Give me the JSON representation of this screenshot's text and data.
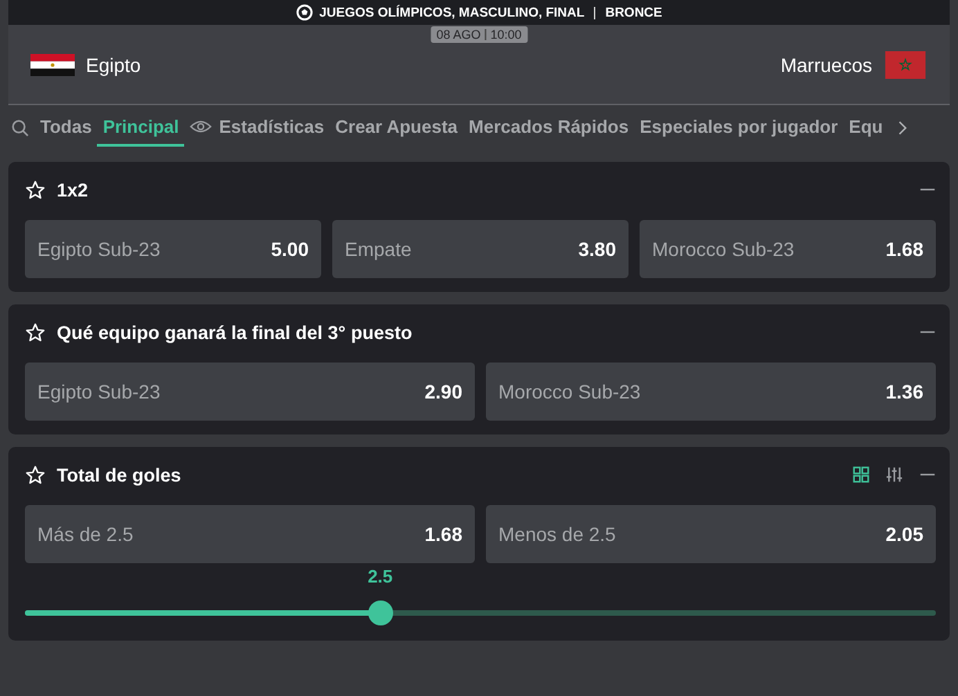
{
  "event": {
    "competition": "JUEGOS OLÍMPICOS, MASCULINO, FINAL",
    "stage": "BRONCE",
    "date": "08 AGO",
    "time": "10:00"
  },
  "teams": {
    "home": "Egipto",
    "away": "Marruecos"
  },
  "tabs": [
    {
      "label": "Todas",
      "selected": false
    },
    {
      "label": "Principal",
      "selected": true
    },
    {
      "label": "Estadísticas",
      "selected": false,
      "kind": "eye"
    },
    {
      "label": "Crear Apuesta",
      "selected": false
    },
    {
      "label": "Mercados Rápidos",
      "selected": false
    },
    {
      "label": "Especiales por jugador",
      "selected": false
    },
    {
      "label": "Equ",
      "selected": false
    }
  ],
  "markets": [
    {
      "title": "1x2",
      "kind": "plain",
      "outcomes": [
        {
          "name": "Egipto Sub-23",
          "odds": "5.00"
        },
        {
          "name": "Empate",
          "odds": "3.80"
        },
        {
          "name": "Morocco Sub-23",
          "odds": "1.68"
        }
      ]
    },
    {
      "title": "Qué equipo ganará la final del 3° puesto",
      "kind": "plain",
      "outcomes": [
        {
          "name": "Egipto Sub-23",
          "odds": "2.90"
        },
        {
          "name": "Morocco Sub-23",
          "odds": "1.36"
        }
      ]
    },
    {
      "title": "Total de goles",
      "kind": "line",
      "outcomes": [
        {
          "name": "Más de 2.5",
          "odds": "1.68"
        },
        {
          "name": "Menos de 2.5",
          "odds": "2.05"
        }
      ],
      "slider": {
        "reading": "2.5",
        "level": 0.39
      }
    }
  ]
}
